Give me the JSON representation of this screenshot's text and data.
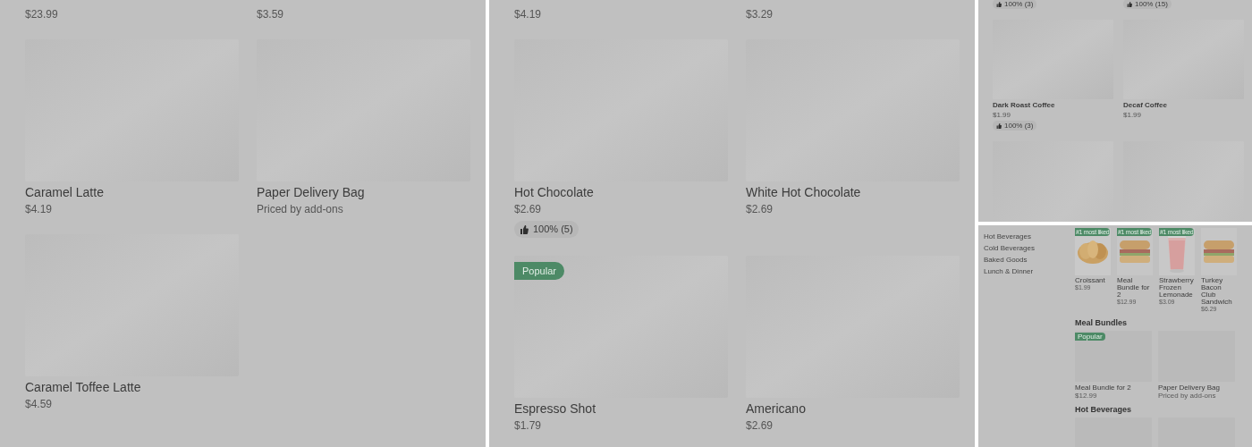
{
  "views": [
    {
      "kind": "large",
      "cards": [
        {
          "cut_top": true,
          "price": "$23.99"
        },
        {
          "cut_top": true,
          "price": "$3.59"
        },
        {
          "name": "Caramel Latte",
          "price": "$4.19"
        },
        {
          "name": "Paper Delivery Bag",
          "price": "Priced by add-ons"
        },
        {
          "name": "Caramel Toffee Latte",
          "price": "$4.59"
        }
      ]
    },
    {
      "kind": "large",
      "cards": [
        {
          "cut_top": true,
          "price": "$4.19"
        },
        {
          "cut_top": true,
          "price": "$3.29"
        },
        {
          "name": "Hot Chocolate",
          "price": "$2.69",
          "rating": "100% (5)"
        },
        {
          "name": "White Hot Chocolate",
          "price": "$2.69"
        },
        {
          "name": "Espresso Shot",
          "price": "$1.79",
          "badge": "Popular"
        },
        {
          "name": "Americano",
          "price": "$2.69"
        }
      ]
    },
    {
      "kind": "compact",
      "cards": [
        {
          "cut_top": true,
          "rating": "100% (3)"
        },
        {
          "cut_top": true,
          "rating": "100% (15)"
        },
        {
          "name": "Dark Roast Coffee",
          "price": "$1.99",
          "rating": "100% (3)"
        },
        {
          "name": "Decaf Coffee",
          "price": "$1.99"
        },
        {
          "cut_bottom": true
        },
        {
          "cut_bottom": true
        }
      ]
    }
  ],
  "store": {
    "sidebar": {
      "items": [
        "Hot Beverages",
        "Cold Beverages",
        "Baked Goods",
        "Lunch & Dinner"
      ]
    },
    "featured": [
      {
        "badge": "#1 most liked",
        "name": "Croissant",
        "price": "$1.99",
        "kind": "croissant"
      },
      {
        "badge": "#1 most liked",
        "name": "Meal Bundle for 2",
        "price": "$12.99",
        "kind": "sandwich"
      },
      {
        "badge": "#1 most liked",
        "name": "Strawberry Frozen Lemonade",
        "price": "$3.09",
        "kind": "drink"
      },
      {
        "name": "Turkey Bacon Club Sandwich",
        "price": "$6.29",
        "kind": "sandwich"
      }
    ],
    "sections": [
      {
        "title": "Meal Bundles",
        "cards": [
          {
            "name": "Meal Bundle for 2",
            "price": "$12.99",
            "badge": "Popular"
          },
          {
            "name": "Paper Delivery Bag",
            "price": "Priced by add-ons"
          }
        ]
      },
      {
        "title": "Hot Beverages",
        "cards": [
          {
            "cut_bottom": true
          },
          {
            "cut_bottom": true
          }
        ]
      }
    ]
  }
}
